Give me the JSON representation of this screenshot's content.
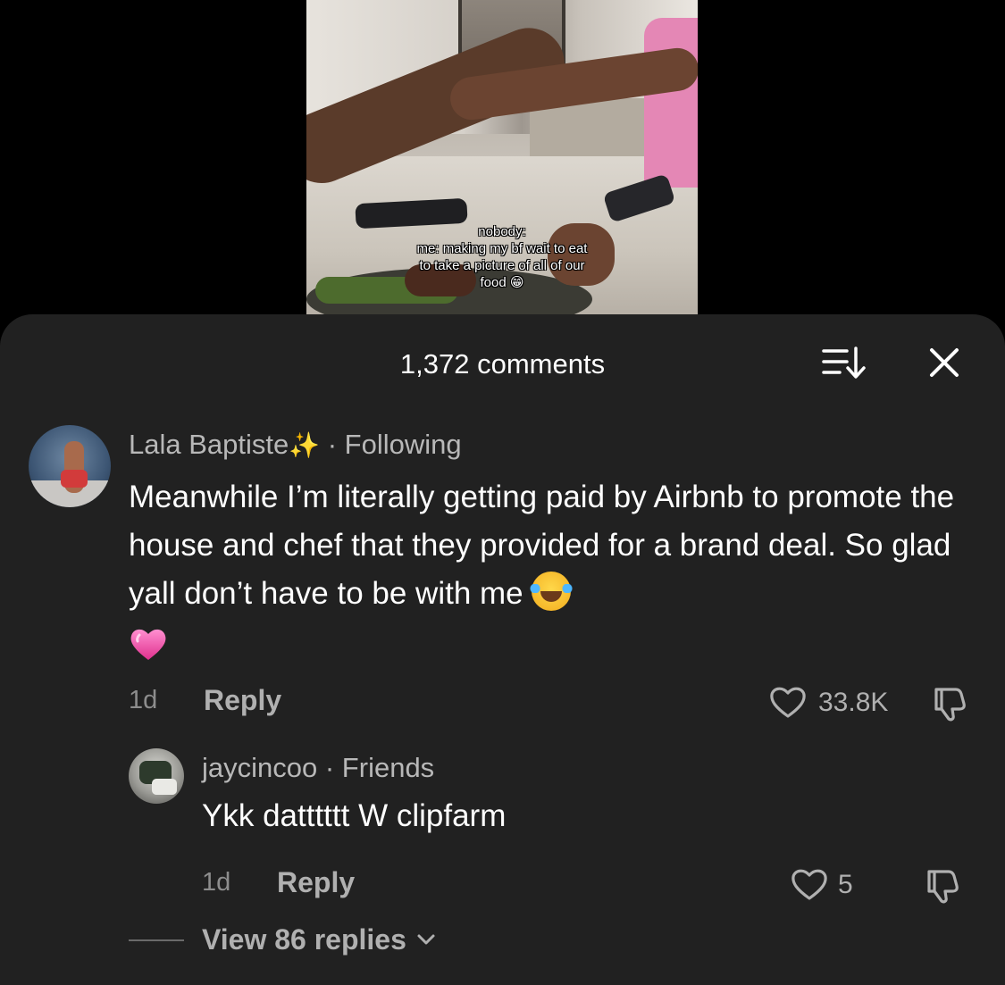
{
  "video": {
    "caption_lines": [
      "nobody:",
      "me: making my bf wait to eat",
      "to take a picture of all of our",
      "food 😁"
    ]
  },
  "comments_panel": {
    "title": "1,372 comments",
    "sort_icon": "sort-icon",
    "close_icon": "close-icon"
  },
  "comment": {
    "author": "Lala Baptiste",
    "author_emoji": "✨",
    "relation": "· Following",
    "text": "Meanwhile I’m literally getting paid by Airbnb to promote the house and chef that they provided for a brand deal. So glad yall don’t have to be with me",
    "emojis": [
      "😂",
      "💗"
    ],
    "time": "1d",
    "reply_label": "Reply",
    "likes": "33.8K",
    "like_icon": "heart-icon",
    "dislike_icon": "thumbs-down-icon"
  },
  "reply": {
    "author": "jaycincoo",
    "relation": "· Friends",
    "text": "Ykk datttttt W clipfarm",
    "time": "1d",
    "reply_label": "Reply",
    "likes": "5"
  },
  "view_replies": {
    "label": "View 86 replies"
  },
  "colors": {
    "sheet_background": "#212121",
    "page_background": "#000000",
    "secondary_text": "#b0b0b0",
    "muted_text": "#8d8d8d",
    "primary_text": "#ffffff"
  }
}
